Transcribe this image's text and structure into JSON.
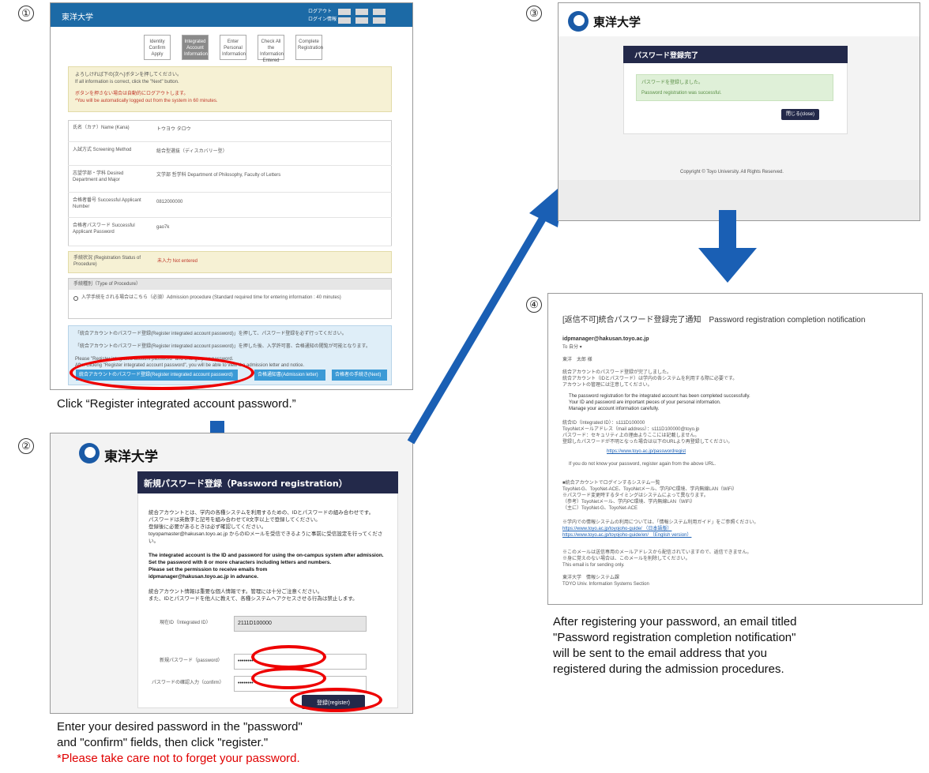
{
  "steps": {
    "one": "①",
    "two": "②",
    "three": "③",
    "four": "④"
  },
  "panel1": {
    "header_title": "東洋大学",
    "header_lines": [
      "ログアウト",
      "ログイン情報"
    ],
    "steps": [
      "Identity Confirm Apply",
      "Integrated Account Information",
      "Enter Personal Information",
      "Check All the Information Entered",
      "Complete Registration"
    ],
    "notice_lines": [
      "よろしければ下の[次へ]ボタンを押してください。",
      "If all information is correct, click the \"Next\" button."
    ],
    "warning_lines": [
      "ボタンを押さない場合は自動的にログアウトします。",
      "*You will be automatically logged out from the system in 60 minutes."
    ],
    "rows": [
      {
        "label": "氏名（カナ）Name (Kana)",
        "value": "トウヨウ タロウ"
      },
      {
        "label": "入試方式 Screening Method",
        "value": "総合型選抜（ディスカバリー型）"
      },
      {
        "label": "志望学部・学科 Desired Department and Major",
        "value": "文学部 哲学科 Department of Philosophy, Faculty of Letters"
      },
      {
        "label": "合格者番号 Successful Applicant Number",
        "value": "0812000000"
      },
      {
        "label": "合格者パスワード Successful Applicant Password",
        "value": "gao7k"
      }
    ],
    "proc_label": "手続状況 (Registration Status of Procedure)",
    "proc_value": "未入力 Not entered",
    "type_label": "手続種別（Type of Procedure）",
    "type_value": "入学手続をされる場合はこちら（必須）Admission procedure (Standard required time for entering information : 40 minutes)",
    "info_lines": [
      "「統合アカウントのパスワード登録(Register integrated account password)」を押して、パスワード登録を必ず行ってください。",
      "「統合アカウントのパスワード登録(Register integrated account password)」を押した後、入学許可書、合格通知の閲覧が可能となります。",
      "Please \"Register integrated account password\" and change your password.",
      "After clicking \"Register integrated account password\", you will be able to view the admission letter and notice."
    ],
    "buttons": [
      "統合アカウントのパスワード登録(Register integrated account password)",
      "合格通知書(Admission letter)",
      "合格者の手続き(Next)"
    ]
  },
  "caption1": "Click “Register integrated account password.”",
  "panel2": {
    "logo": "東洋大学",
    "title": "新規パスワード登録（Password registration）",
    "jp_lines": [
      "統合アカウントとは、学内の各種システムを利用するための、IDとパスワードの組み合わせです。",
      "パスワードは英数字と記号を組み合わせて8文字以上で登録してください。",
      "登録後に必要があるときは必ず確認してください。",
      "toyopamaster@hakusan.toyo.ac.jp からのIDメールを受信できるように事前に受信設定を行ってください。"
    ],
    "en_lines": [
      "The integrated account is the ID and password for using the on-campus system after admission.",
      "Set the password with 8 or more characters including letters and numbers.",
      "Please set the permission to receive emails from",
      "idpmanager@hakusan.toyo.ac.jp in advance."
    ],
    "jp2_lines": [
      "統合アカウント情報は重要な個人情報です。管理には十分ご注意ください。",
      "また、IDとパスワードを他人に教えて、各種システムへアクセスさせる行為は禁止します。"
    ],
    "id_label": "現在ID（Integrated ID）",
    "id_value": "2111D100000",
    "pw_label": "新規パスワード（password）",
    "pw_value": "••••••••",
    "confirm_label": "パスワードの確認入力（confirm）",
    "confirm_value": "••••••••",
    "register": "登録(register)"
  },
  "caption2": [
    "Enter your desired password in the \"password\"",
    "and \"confirm\" fields, then click \"register.\""
  ],
  "caption2_warning": "*Please take care not to forget your password.",
  "panel3": {
    "logo": "東洋大学",
    "title": "パスワード登録完了",
    "success_lines": [
      "パスワードを登録しました。",
      "Password registration was successful."
    ],
    "close": "閉じる(close)",
    "copyright": "Copyright © Toyo University. All Rights Reserved."
  },
  "panel4": {
    "title": "[返信不可]統合パスワード登録完了通知　Password registration completion notification",
    "from": "idpmanager@hakusan.toyo.ac.jp",
    "to": "To 自分 ▾",
    "greeting": "東洋　太郎 様",
    "jp_body": [
      "統合アカウントのパスワード登録が完了しました。",
      "統合アカウント（IDとパスワード）は学内の各システムを利用する際に必要です。",
      "アカウントの管理には注意してください。"
    ],
    "en_body": [
      "The password registration for the integrated account has been completed successfully.",
      "Your ID and password are important pieces of your personal information.",
      "Manage your account information carefully."
    ],
    "id_lines": [
      "統合ID（Integrated ID）：s111D100000",
      "ToyoNetメールアドレス（mail address）：s111D100000@toyo.jp",
      "パスワード：セキュリティ上の理由よりここには記載しません。",
      "登録したパスワードが不明となった場合は以下のURLより再登録してください。"
    ],
    "link1": "https://www.toyo.ac.jp/passwordregist",
    "note": "If you do not know your password, register again from the above URL.",
    "sys_lines": [
      "■統合アカウントでログインするシステム一覧",
      "ToyoNet-G、ToyoNet-ACE、ToyoNetメール、学内PC環境、学内無線LAN（WiFi）",
      "※パスワード変更時するタイミングはシステムによって異なります。",
      "（参考）ToyoNetメール、学内PC環境、学内無線LAN（WiFi）",
      "（主に）ToyoNet-G、ToyoNet-ACE"
    ],
    "guide_line": "※学内での情報システムの利用については、「情報システム利用ガイド」をご参照ください。",
    "link2": "https://www.toyo.ac.jp/toyojoho-guide/ （日本語版）",
    "link3": "https://www.toyo.ac.jp/toyojoho-guide/en/ （English version）",
    "footer_lines": [
      "※このメールは送信専用のメールアドレスから配信されていますので、返信できません。",
      "※身に覚えのない場合は、このメールを削除してください。",
      "This email is for sending only."
    ],
    "sign_lines": [
      "東洋大学　情報システム課",
      "TOYO Univ. Information Systems Section"
    ]
  },
  "caption4": [
    "After registering your password, an email titled",
    "\"Password registration completion notification\"",
    "will be sent to the email address that you",
    "registered during the admission procedures."
  ],
  "colors": {
    "blue": "#1a5fb4",
    "red": "#e00000",
    "navy": "#23294a",
    "header_blue": "#1c6aa6"
  }
}
